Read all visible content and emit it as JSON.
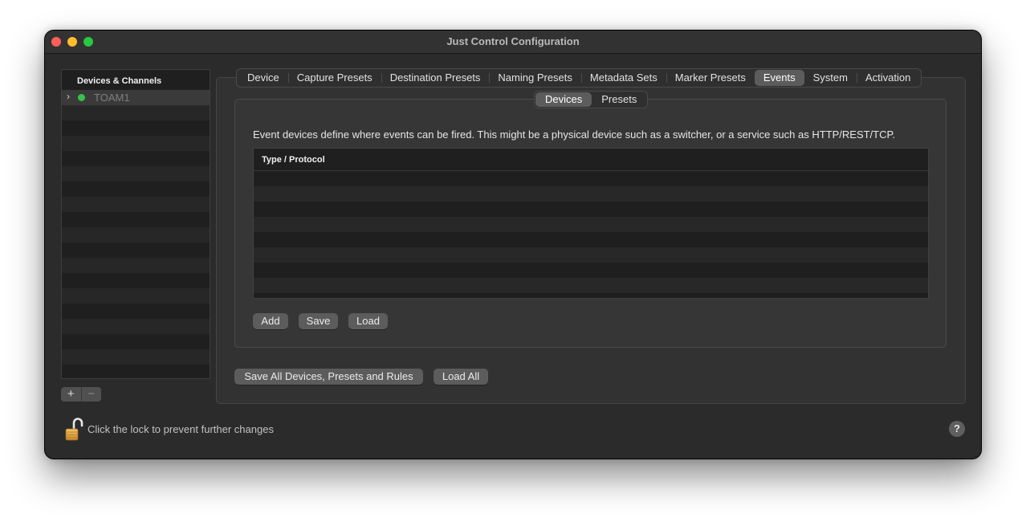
{
  "window": {
    "title": "Just Control Configuration"
  },
  "sidebar": {
    "header": "Devices & Channels",
    "items": [
      {
        "label": "TOAM1",
        "status_color": "#35c24a"
      }
    ],
    "add_label": "+",
    "remove_label": "−"
  },
  "tabs": [
    "Device",
    "Capture Presets",
    "Destination Presets",
    "Naming Presets",
    "Metadata Sets",
    "Marker Presets",
    "Events",
    "System",
    "Activation"
  ],
  "active_tab": "Events",
  "subtabs": [
    "Devices",
    "Presets"
  ],
  "active_subtab": "Devices",
  "events": {
    "description": "Event devices define where events can be fired. This might be a physical device such as a switcher, or a service such as HTTP/REST/TCP.",
    "table_header": "Type / Protocol",
    "rows": [],
    "add_label": "Add",
    "save_label": "Save",
    "load_label": "Load"
  },
  "footer": {
    "save_all_label": "Save All Devices, Presets and Rules",
    "load_all_label": "Load All",
    "lock_text": "Click the lock to prevent further changes",
    "help_label": "?"
  },
  "icons": {
    "lock": "lock-open-icon",
    "help": "help-icon",
    "expand": "chevron-right-icon"
  }
}
